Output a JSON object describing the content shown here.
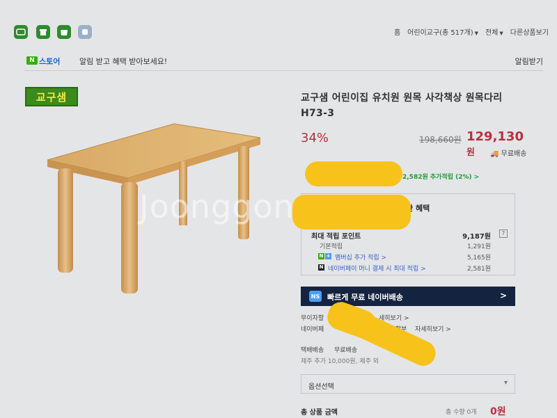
{
  "toolbar": {
    "icons": [
      "naver-app-icon",
      "shop-icon",
      "store-icon",
      "cart-icon"
    ],
    "nav": {
      "home": "홈",
      "category": "어린이교구(총 517개)",
      "all": "전체",
      "other": "다른상품보기"
    }
  },
  "alert": {
    "badge": "N",
    "store": "스토어",
    "text": "알림 받고 혜택 받아보세요!",
    "action": "알림받기"
  },
  "brand": {
    "logo_text": "교구샘"
  },
  "product": {
    "title": "교구샘 어린이집 유치원 원목 사각책상 원목다리 H73-3",
    "discount": "34%",
    "original_price": "198,660원",
    "sale_price": "129,130",
    "currency": "원",
    "shipping": "무료배송",
    "extra_points": "2,582원 추가적립 (2%) >"
  },
  "benefits": {
    "title": "한 혜택",
    "max_points_label": "최대 적립 포인트",
    "max_points_value": "9,187원",
    "rows": [
      {
        "label": "기본적립",
        "value": "1,291원"
      },
      {
        "label": "멤버십 추가 적립 >",
        "value": "5,165원"
      },
      {
        "label": "네이버페이 머니 결제 시 최대 적립 >",
        "value": "2,581원"
      }
    ]
  },
  "naver_shipping": {
    "badge": "NS",
    "label": "빠르게 무료 네이버배송",
    "chevron": ">"
  },
  "installment": {
    "line1_a": "무이자할",
    "line1_b": "세히보기 >",
    "line2_a": "네이버페",
    "line2_b": "무이자 할부",
    "line2_c": "자세히보기 >"
  },
  "delivery": {
    "label": "택배배송",
    "value": "무료배송",
    "jeju": "제주 추가 10,000원, 제주 외"
  },
  "order": {
    "option_label": "옵션선택",
    "total_label": "총 상품 금액",
    "total_qty": "총 수량 0개",
    "total_value": "0원"
  },
  "colors": {
    "price_red": "#b8303e",
    "naver_green": "#2db400",
    "naver_ship_navy": "#14233f",
    "redaction_yellow": "#f7c31b"
  }
}
